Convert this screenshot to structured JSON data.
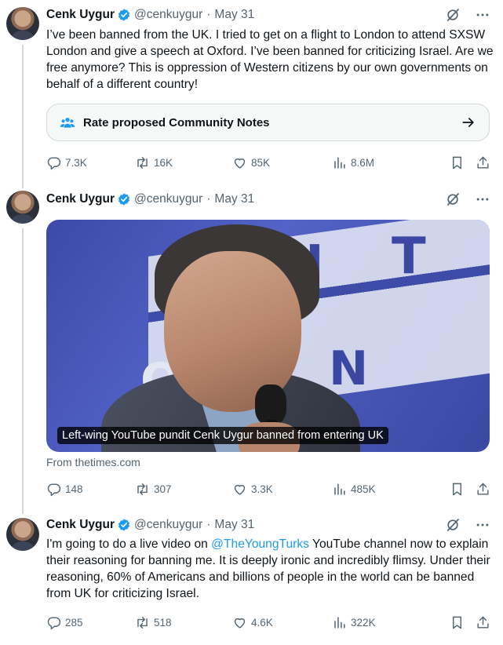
{
  "colors": {
    "accent": "#1d9bf0",
    "muted": "#536471",
    "text": "#0f1419",
    "border": "#cfd9de"
  },
  "icons": {
    "verified": "verified-badge-icon",
    "grok": "grok-icon",
    "more": "more-icon",
    "notes": "community-notes-icon",
    "arrow": "arrow-right-icon",
    "reply": "reply-icon",
    "retweet": "retweet-icon",
    "like": "heart-icon",
    "views": "views-icon",
    "bookmark": "bookmark-icon",
    "share": "share-icon"
  },
  "tweets": [
    {
      "name": "Cenk Uygur",
      "handle": "@cenkuygur",
      "separator": "·",
      "date": "May 31",
      "text": "I’ve been banned from the UK. I tried to get on a flight to London to attend SXSW London and give a speech at Oxford. I’ve been banned for criticizing Israel. Are we free anymore? This is oppression of Western citizens by our own governments on behalf of a different country!",
      "community_notes": "Rate proposed Community Notes",
      "stats": {
        "replies": "7.3K",
        "retweets": "16K",
        "likes": "85K",
        "views": "8.6M"
      }
    },
    {
      "name": "Cenk Uygur",
      "handle": "@cenkuygur",
      "separator": "·",
      "date": "May 31",
      "card_caption": "Left-wing YouTube pundit Cenk Uygur banned from entering UK",
      "card_source": "From thetimes.com",
      "stats": {
        "replies": "148",
        "retweets": "307",
        "likes": "3.3K",
        "views": "485K"
      }
    },
    {
      "name": "Cenk Uygur",
      "handle": "@cenkuygur",
      "separator": "·",
      "date": "May 31",
      "text_before": "I'm going to do a live video on ",
      "mention": "@TheYoungTurks",
      "text_after": " YouTube channel now to explain their reasoning for banning me. It is deeply ironic and incredibly flimsy. Under their reasoning, 60% of Americans and billions of people in the world can be banned from UK for criticizing Israel.",
      "stats": {
        "replies": "285",
        "retweets": "518",
        "likes": "4.6K",
        "views": "322K"
      }
    }
  ]
}
